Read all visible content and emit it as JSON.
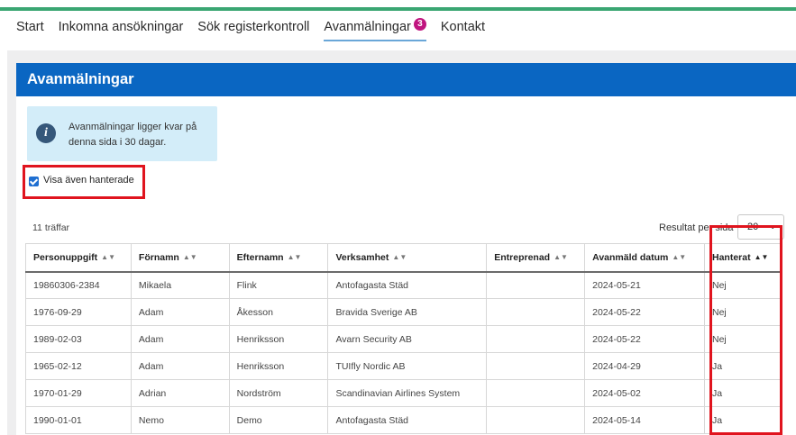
{
  "nav": {
    "items": [
      {
        "label": "Start"
      },
      {
        "label": "Inkomna ansökningar"
      },
      {
        "label": "Sök registerkontroll"
      },
      {
        "label": "Avanmälningar",
        "badge": "3",
        "active": true
      },
      {
        "label": "Kontakt"
      }
    ]
  },
  "panel": {
    "title": "Avanmälningar",
    "info": {
      "icon": "info-icon",
      "text": "Avanmälningar ligger kvar på denna sida i 30 dagar."
    },
    "show_handled": {
      "label": "Visa även hanterade",
      "checked": true
    },
    "hits": "11 träffar",
    "per_page": {
      "label": "Resultat per sida",
      "value": "20"
    }
  },
  "table": {
    "columns": [
      "Personuppgift",
      "Förnamn",
      "Efternamn",
      "Verksamhet",
      "Entreprenad",
      "Avanmäld datum",
      "Hanterat"
    ],
    "rows": [
      [
        "19860306-2384",
        "Mikaela",
        "Flink",
        "Antofagasta Städ",
        "",
        "2024-05-21",
        "Nej"
      ],
      [
        "1976-09-29",
        "Adam",
        "Åkesson",
        "Bravida Sverige AB",
        "",
        "2024-05-22",
        "Nej"
      ],
      [
        "1989-02-03",
        "Adam",
        "Henriksson",
        "Avarn Security AB",
        "",
        "2024-05-22",
        "Nej"
      ],
      [
        "1965-02-12",
        "Adam",
        "Henriksson",
        "TUIfly Nordic AB",
        "",
        "2024-04-29",
        "Ja"
      ],
      [
        "1970-01-29",
        "Adrian",
        "Nordström",
        "Scandinavian Airlines System",
        "",
        "2024-05-02",
        "Ja"
      ],
      [
        "1990-01-01",
        "Nemo",
        "Demo",
        "Antofagasta Städ",
        "",
        "2024-05-14",
        "Ja"
      ]
    ]
  },
  "colors": {
    "accent_strip": "#3aa672",
    "header_blue": "#0a66c2",
    "badge": "#c0157f",
    "highlight": "#e0141e",
    "info_bg": "#d3edf9"
  }
}
